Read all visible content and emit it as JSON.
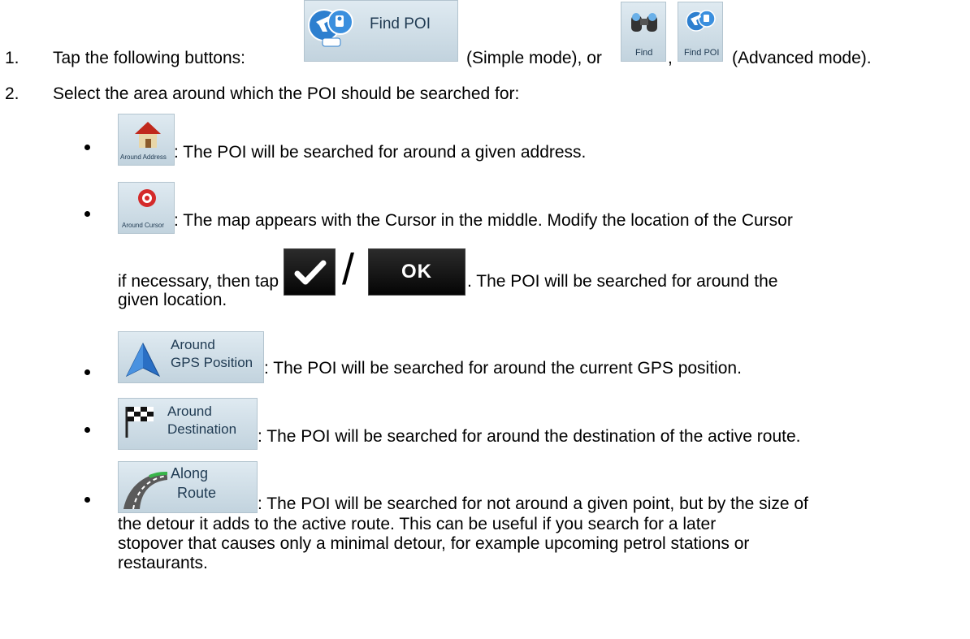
{
  "step1": {
    "number": "1.",
    "prefix": "Tap the following buttons:",
    "find_poi_label": "Find POI",
    "simple_mode": "(Simple mode), or",
    "comma": ",",
    "find_label": "Find",
    "find_poi_small_label": "Find POI",
    "advanced_mode": "(Advanced mode)."
  },
  "step2": {
    "number": "2.",
    "text": "Select the area around which the POI should be searched for:"
  },
  "options": [
    {
      "button_label": "Around Address",
      "icon": "house-icon",
      "lines": [
        ": The POI will be searched for around a given address."
      ]
    },
    {
      "button_label": "Around Cursor",
      "icon": "cursor-target-icon",
      "lines": [
        ": The map appears with the Cursor in the middle. Modify the location of the Cursor",
        "if necessary, then tap",
        ". The POI will be searched for around the",
        "given location."
      ],
      "confirm_glyph": "checkmark-icon",
      "slash": "/",
      "ok_label": "OK"
    },
    {
      "button_label_line1": "Around",
      "button_label_line2": "GPS Position",
      "icon": "gps-arrow-icon",
      "lines": [
        ": The POI will be searched for around the current GPS position."
      ]
    },
    {
      "button_label_line1": "Around",
      "button_label_line2": "Destination",
      "icon": "checkered-flag-icon",
      "lines": [
        ": The POI will be searched for around the destination of the active route."
      ]
    },
    {
      "button_label_line1": "Along",
      "button_label_line2": "Route",
      "icon": "road-icon",
      "lines": [
        ": The POI will be searched for not around a given point, but by the size of",
        "the detour it adds to the active route. This can be useful if you search for a later",
        "stopover that causes only a minimal detour, for example upcoming petrol stations or",
        "restaurants."
      ]
    }
  ],
  "colors": {
    "tile_top": "#dfeaf1",
    "tile_bottom": "#c2d3de",
    "tile_text": "#1f3a52",
    "dark_button": "#0a0a0a"
  }
}
